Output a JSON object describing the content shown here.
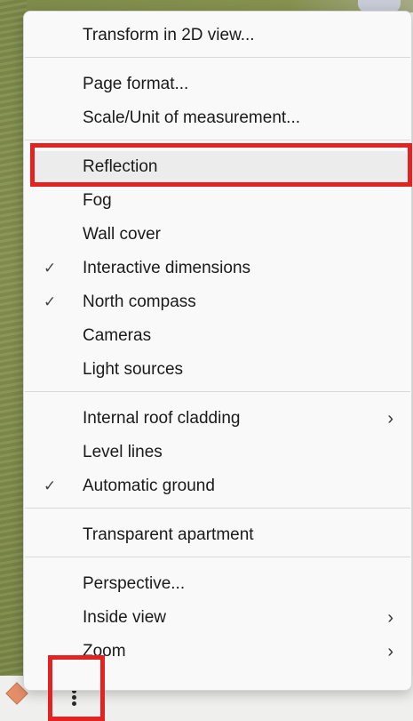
{
  "menu": {
    "groups": [
      [
        {
          "label": "Transform in 2D view...",
          "checked": false,
          "submenu": false
        }
      ],
      [
        {
          "label": "Page format...",
          "checked": false,
          "submenu": false
        },
        {
          "label": "Scale/Unit of measurement...",
          "checked": false,
          "submenu": false
        }
      ],
      [
        {
          "label": "Reflection",
          "checked": false,
          "submenu": false,
          "highlighted": true
        },
        {
          "label": "Fog",
          "checked": false,
          "submenu": false
        },
        {
          "label": "Wall cover",
          "checked": false,
          "submenu": false
        },
        {
          "label": "Interactive dimensions",
          "checked": true,
          "submenu": false
        },
        {
          "label": "North compass",
          "checked": true,
          "submenu": false
        },
        {
          "label": "Cameras",
          "checked": false,
          "submenu": false
        },
        {
          "label": "Light sources",
          "checked": false,
          "submenu": false
        }
      ],
      [
        {
          "label": "Internal roof cladding",
          "checked": false,
          "submenu": true
        },
        {
          "label": "Level lines",
          "checked": false,
          "submenu": false
        },
        {
          "label": "Automatic ground",
          "checked": true,
          "submenu": false
        }
      ],
      [
        {
          "label": "Transparent apartment",
          "checked": false,
          "submenu": false
        }
      ],
      [
        {
          "label": "Perspective...",
          "checked": false,
          "submenu": false
        },
        {
          "label": "Inside view",
          "checked": false,
          "submenu": true
        },
        {
          "label": "Zoom",
          "checked": false,
          "submenu": true
        }
      ]
    ],
    "check_glyph": "✓",
    "chevron_glyph": "›"
  },
  "icons": {
    "diamond": "diamond-icon",
    "more": "more-vert-icon"
  },
  "colors": {
    "highlight_border": "#e32222",
    "menu_background": "#f9f9f9",
    "hover_background": "#ececec"
  }
}
